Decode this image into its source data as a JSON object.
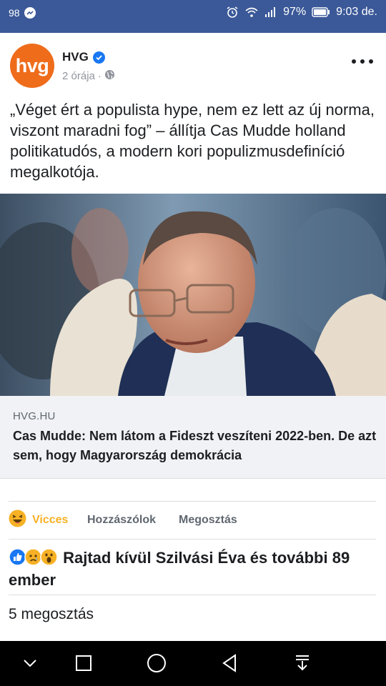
{
  "status_bar": {
    "battery_small": "98",
    "battery": "97%",
    "time": "9:03 de."
  },
  "post": {
    "page_name": "HVG",
    "avatar_text": "hvg",
    "time_ago": "2 órája",
    "text": "„Véget ért a populista hype, nem ez lett az új norma, viszont maradni fog” – állítja Cas Mudde holland politikatudós, a modern kori populizmusdefiníció megalkotója.",
    "link": {
      "domain": "HVG.HU",
      "title": "Cas Mudde: Nem látom a Fideszt veszíteni 2022-ben. De azt sem, hogy Magyarország demokrácia"
    }
  },
  "actions": {
    "react_label": "Vicces",
    "comment_label": "Hozzászólok",
    "share_label": "Megosztás"
  },
  "reaction_summary": "Rajtad kívül Szilvási Éva és további 89 ember",
  "share_count": "5 megosztás",
  "colors": {
    "status_bar": "#3b5998",
    "avatar": "#ef6c1b",
    "verified": "#1877f2",
    "haha": "#f7b125"
  },
  "icons": [
    "messenger-icon",
    "alarm-icon",
    "wifi-icon",
    "signal-icon",
    "battery-icon",
    "verified-icon",
    "globe-icon",
    "more-options-icon",
    "haha-reaction-icon",
    "like-reaction-icon",
    "sad-reaction-icon",
    "wow-reaction-icon",
    "back-icon",
    "home-icon",
    "recents-icon",
    "chevron-down-icon",
    "notification-pull-icon"
  ]
}
